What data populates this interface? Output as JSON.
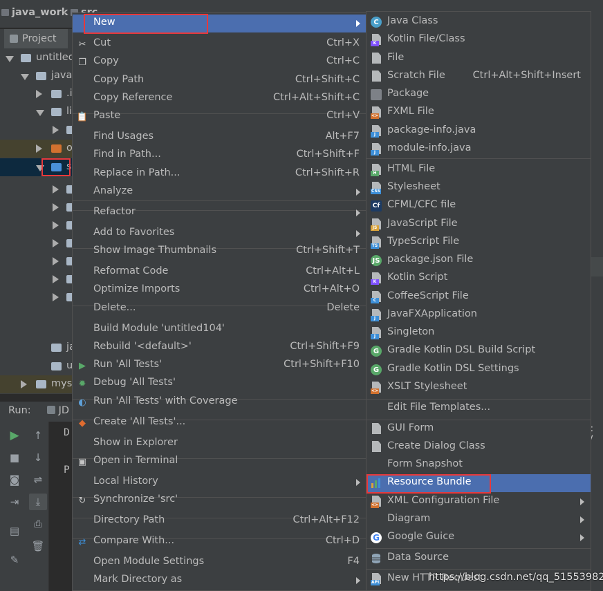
{
  "breadcrumb": {
    "project": "java_work",
    "next": "src"
  },
  "project_tab": {
    "label": "Project"
  },
  "tree": {
    "items": [
      {
        "label": "untitled"
      },
      {
        "label": "java_"
      },
      {
        "label": ".i"
      },
      {
        "label": "li"
      },
      {
        "label": ""
      },
      {
        "label": "o"
      },
      {
        "label": "s"
      },
      {
        "label": "ja"
      },
      {
        "label": "u"
      },
      {
        "label": "mys"
      }
    ]
  },
  "run": {
    "label": "Run:",
    "tab": "JD",
    "console_line1": "D",
    "console_line2": "P:",
    "right_fragment": "): V"
  },
  "left_menu": {
    "items": [
      {
        "label": "New",
        "shortcut": ""
      },
      {
        "label": "Cut",
        "shortcut": "Ctrl+X"
      },
      {
        "label": "Copy",
        "shortcut": "Ctrl+C"
      },
      {
        "label": "Copy Path",
        "shortcut": "Ctrl+Shift+C"
      },
      {
        "label": "Copy Reference",
        "shortcut": "Ctrl+Alt+Shift+C"
      },
      {
        "label": "Paste",
        "shortcut": "Ctrl+V"
      },
      {
        "label": "Find Usages",
        "shortcut": "Alt+F7"
      },
      {
        "label": "Find in Path...",
        "shortcut": "Ctrl+Shift+F"
      },
      {
        "label": "Replace in Path...",
        "shortcut": "Ctrl+Shift+R"
      },
      {
        "label": "Analyze",
        "shortcut": ""
      },
      {
        "label": "Refactor",
        "shortcut": ""
      },
      {
        "label": "Add to Favorites",
        "shortcut": ""
      },
      {
        "label": "Show Image Thumbnails",
        "shortcut": "Ctrl+Shift+T"
      },
      {
        "label": "Reformat Code",
        "shortcut": "Ctrl+Alt+L"
      },
      {
        "label": "Optimize Imports",
        "shortcut": "Ctrl+Alt+O"
      },
      {
        "label": "Delete...",
        "shortcut": "Delete"
      },
      {
        "label": "Build Module 'untitled104'",
        "shortcut": ""
      },
      {
        "label": "Rebuild '<default>'",
        "shortcut": "Ctrl+Shift+F9"
      },
      {
        "label": "Run 'All Tests'",
        "shortcut": "Ctrl+Shift+F10"
      },
      {
        "label": "Debug 'All Tests'",
        "shortcut": ""
      },
      {
        "label": "Run 'All Tests' with Coverage",
        "shortcut": ""
      },
      {
        "label": "Create 'All Tests'...",
        "shortcut": ""
      },
      {
        "label": "Show in Explorer",
        "shortcut": ""
      },
      {
        "label": "Open in Terminal",
        "shortcut": ""
      },
      {
        "label": "Local History",
        "shortcut": ""
      },
      {
        "label": "Synchronize 'src'",
        "shortcut": ""
      },
      {
        "label": "Directory Path",
        "shortcut": "Ctrl+Alt+F12"
      },
      {
        "label": "Compare With...",
        "shortcut": "Ctrl+D"
      },
      {
        "label": "Open Module Settings",
        "shortcut": "F4"
      },
      {
        "label": "Mark Directory as",
        "shortcut": ""
      }
    ]
  },
  "right_menu": {
    "items": [
      {
        "label": "Java Class",
        "shortcut": ""
      },
      {
        "label": "Kotlin File/Class",
        "shortcut": ""
      },
      {
        "label": "File",
        "shortcut": ""
      },
      {
        "label": "Scratch File",
        "shortcut": "Ctrl+Alt+Shift+Insert"
      },
      {
        "label": "Package",
        "shortcut": ""
      },
      {
        "label": "FXML File",
        "shortcut": ""
      },
      {
        "label": "package-info.java",
        "shortcut": ""
      },
      {
        "label": "module-info.java",
        "shortcut": ""
      },
      {
        "label": "HTML File",
        "shortcut": ""
      },
      {
        "label": "Stylesheet",
        "shortcut": ""
      },
      {
        "label": "CFML/CFC file",
        "shortcut": ""
      },
      {
        "label": "JavaScript File",
        "shortcut": ""
      },
      {
        "label": "TypeScript File",
        "shortcut": ""
      },
      {
        "label": "package.json File",
        "shortcut": ""
      },
      {
        "label": "Kotlin Script",
        "shortcut": ""
      },
      {
        "label": "CoffeeScript File",
        "shortcut": ""
      },
      {
        "label": "JavaFXApplication",
        "shortcut": ""
      },
      {
        "label": "Singleton",
        "shortcut": ""
      },
      {
        "label": "Gradle Kotlin DSL Build Script",
        "shortcut": ""
      },
      {
        "label": "Gradle Kotlin DSL Settings",
        "shortcut": ""
      },
      {
        "label": "XSLT Stylesheet",
        "shortcut": ""
      },
      {
        "label": "Edit File Templates...",
        "shortcut": ""
      },
      {
        "label": "GUI Form",
        "shortcut": ""
      },
      {
        "label": "Create Dialog Class",
        "shortcut": ""
      },
      {
        "label": "Form Snapshot",
        "shortcut": ""
      },
      {
        "label": "Resource Bundle",
        "shortcut": ""
      },
      {
        "label": "XML Configuration File",
        "shortcut": ""
      },
      {
        "label": "Diagram",
        "shortcut": ""
      },
      {
        "label": "Google Guice",
        "shortcut": ""
      },
      {
        "label": "Data Source",
        "shortcut": ""
      },
      {
        "label": "New HTTP Request",
        "shortcut": ""
      }
    ]
  },
  "watermark": "https://blog.csdn.net/qq_51553982",
  "colors": {
    "selection": "#4b6eaf",
    "highlight_box": "#e8393b",
    "menu_bg": "#3c3f41"
  }
}
